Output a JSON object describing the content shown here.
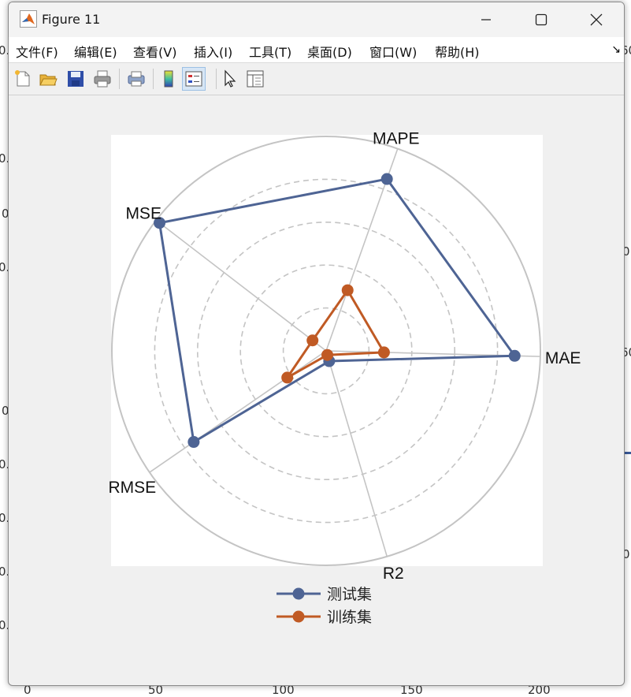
{
  "window": {
    "title": "Figure 11",
    "controls": [
      "minimize",
      "maximize",
      "close"
    ]
  },
  "menubar": {
    "items": [
      "文件(F)",
      "编辑(E)",
      "查看(V)",
      "插入(I)",
      "工具(T)",
      "桌面(D)",
      "窗口(W)",
      "帮助(H)"
    ]
  },
  "toolbar": {
    "buttons": [
      "new-figure-icon",
      "open-file-icon",
      "save-icon",
      "print-icon",
      "print-preview-icon",
      "colorbar-icon",
      "legend-icon",
      "pointer-icon",
      "property-inspector-icon"
    ]
  },
  "background_figure": {
    "left_ticks": [
      "0.",
      "0.",
      "0",
      "0.",
      "0",
      "0.",
      "0.",
      "0.",
      "0."
    ],
    "bottom_ticks": [
      "0",
      "50",
      "100",
      "150",
      "200"
    ],
    "right_ticks": [
      "60",
      "0",
      "60",
      "0"
    ]
  },
  "chart_data": {
    "type": "radar",
    "axes": [
      "MAE",
      "MAPE",
      "MSE",
      "RMSE",
      "R2"
    ],
    "rmax": 1.0,
    "rings": [
      0.2,
      0.4,
      0.6,
      0.8,
      1.0
    ],
    "series": [
      {
        "name": "测试集",
        "color": "#4e6494",
        "values": [
          0.88,
          0.85,
          0.98,
          0.75,
          0.05
        ]
      },
      {
        "name": "训练集",
        "color": "#c05a24",
        "values": [
          0.27,
          0.3,
          0.08,
          0.22,
          0.02
        ]
      }
    ],
    "legend_position": "bottom"
  }
}
